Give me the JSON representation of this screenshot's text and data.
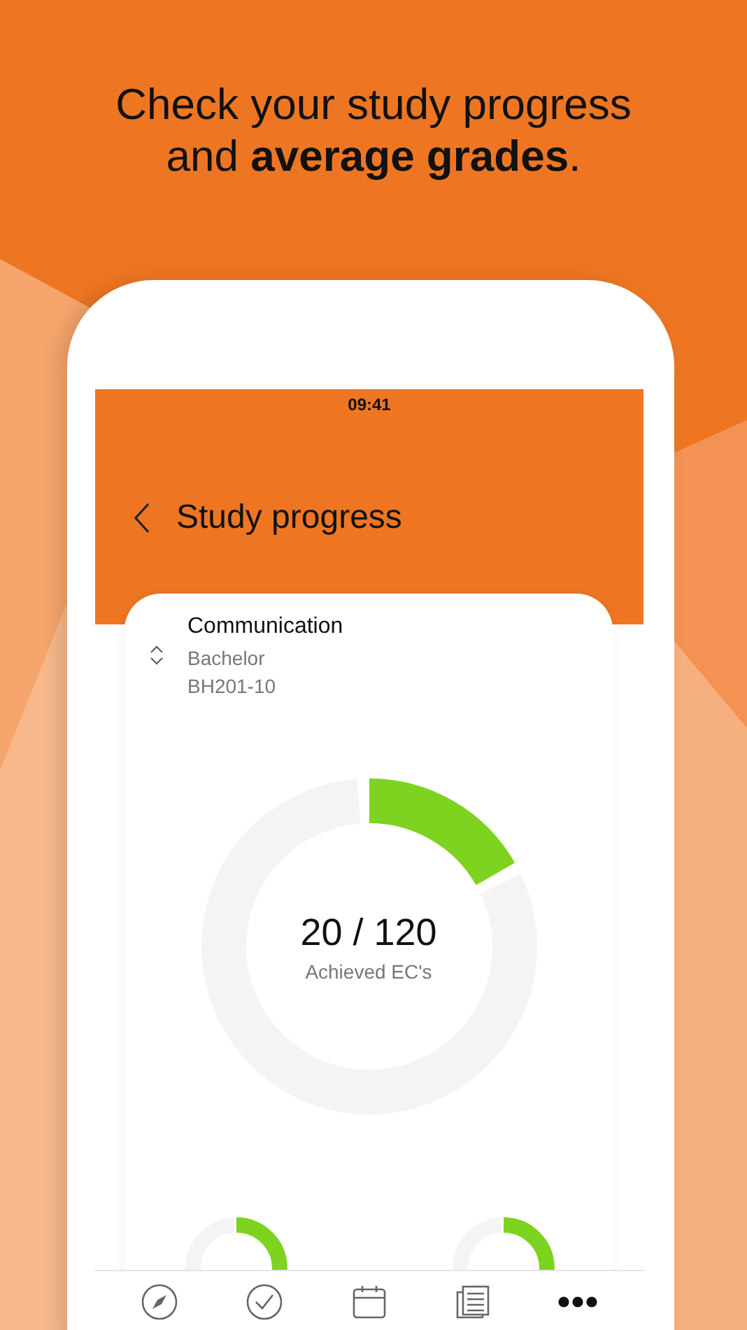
{
  "headline": "Check your study progress and **average grades**.",
  "status_bar": {
    "time": "09:41"
  },
  "header": {
    "title": "Study progress"
  },
  "program": {
    "name": "Communication",
    "level_name": "Bachelor",
    "code": "BH201-10"
  },
  "main_ring": {
    "value": "20 / 120",
    "caption": "Achieved EC's",
    "level": 0.167
  },
  "small_rings": [
    {
      "level": 0.3
    },
    {
      "level": 0.28
    }
  ],
  "tab_bar": [
    {
      "kind": "compass"
    },
    {
      "kind": "check"
    },
    {
      "kind": "calendar"
    },
    {
      "kind": "news"
    },
    {
      "kind": "more"
    }
  ]
}
